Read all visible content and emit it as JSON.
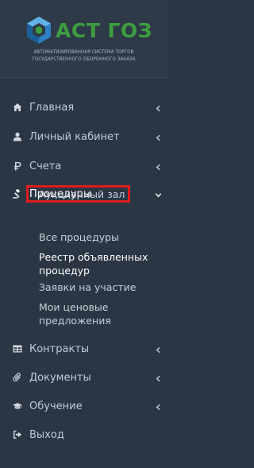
{
  "brand": {
    "name": "АСТ ГОЗ",
    "tagline_line1": "Автоматизированная система торгов",
    "tagline_line2": "государственного оборонного заказа",
    "accent_color": "#3c9e3f"
  },
  "menu": {
    "items": [
      {
        "label": "Главная",
        "icon": "home-icon"
      },
      {
        "label": "Личный кабинет",
        "icon": "user-icon"
      },
      {
        "label": "Счета",
        "icon": "ruble-icon"
      },
      {
        "label": "Процедуры",
        "icon": "gavel-icon",
        "expanded": true
      },
      {
        "label": "Контракты",
        "icon": "table-icon"
      },
      {
        "label": "Документы",
        "icon": "paperclip-icon"
      },
      {
        "label": "Обучение",
        "icon": "graduation-cap-icon"
      },
      {
        "label": "Выход",
        "icon": "sign-out-icon"
      }
    ],
    "procedures_submenu": [
      {
        "label": "Аукционный зал",
        "highlighted": true
      },
      {
        "label": "Все процедуры"
      },
      {
        "label": "Реестр объявленных",
        "label_line2": "процедур"
      },
      {
        "label": "Заявки на участие"
      },
      {
        "label": "Мои ценовые",
        "label_line2": "предложения"
      }
    ],
    "highlight_color": "#e01b1b"
  }
}
